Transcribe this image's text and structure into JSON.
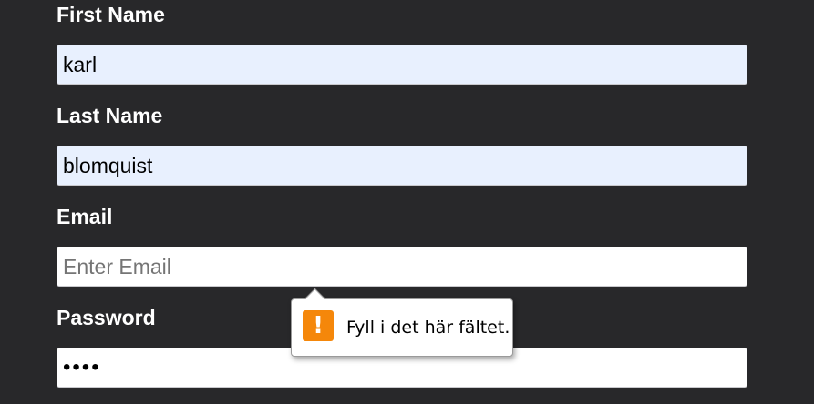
{
  "form": {
    "first_name": {
      "label": "First Name",
      "value": "karl"
    },
    "last_name": {
      "label": "Last Name",
      "value": "blomquist"
    },
    "email": {
      "label": "Email",
      "value": "",
      "placeholder": "Enter Email"
    },
    "password": {
      "label": "Password",
      "value": "••••"
    }
  },
  "validation_tooltip": {
    "icon": "exclamation-warning-icon",
    "icon_glyph": "!",
    "message": "Fyll i det här fältet."
  },
  "colors": {
    "background": "#28282a",
    "autofill": "#e8f0fe",
    "warning": "#f5870a"
  }
}
